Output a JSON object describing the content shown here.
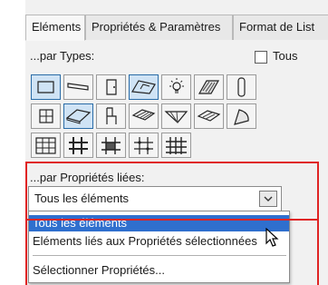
{
  "tabs": [
    "Eléments",
    "Propriétés & Paramètres",
    "Format de List"
  ],
  "types_section": {
    "label": "...par Types:",
    "all_label": "Tous",
    "all_checked": false,
    "row1": [
      {
        "name": "wall-tool-icon",
        "on": true
      },
      {
        "name": "beam-tool-icon",
        "on": false
      },
      {
        "name": "door-tool-icon",
        "on": false
      },
      {
        "name": "window-tool-icon",
        "on": true
      },
      {
        "name": "lamp-tool-icon",
        "on": false
      },
      {
        "name": "roof-tool-icon",
        "on": false
      },
      {
        "name": "column-tool-icon",
        "on": false
      }
    ],
    "row2": [
      {
        "name": "object-tool-icon",
        "on": false
      },
      {
        "name": "slab-tool-icon",
        "on": true
      },
      {
        "name": "chair-tool-icon",
        "on": false
      },
      {
        "name": "stair-tool-icon",
        "on": false
      },
      {
        "name": "mesh-tool-icon",
        "on": false
      },
      {
        "name": "morph-tool-icon",
        "on": false
      },
      {
        "name": "shell-tool-icon",
        "on": false
      }
    ],
    "row3": [
      {
        "name": "curtain-wall-tool-icon",
        "on": false
      },
      {
        "name": "frame-tool-icon",
        "on": false
      },
      {
        "name": "panel-tool-icon",
        "on": false
      },
      {
        "name": "junction-tool-icon",
        "on": false
      },
      {
        "name": "accessory-tool-icon",
        "on": false
      }
    ]
  },
  "linked_section": {
    "label": "...par Propriétés liées:",
    "selected": "Tous les éléments",
    "options": [
      "Tous les éléments",
      "Eléments liés aux Propriétés sélectionnées",
      "Sélectionner Propriétés..."
    ],
    "highlighted_index": 0
  },
  "colors": {
    "highlight": "#2f6fce",
    "toggle_on": "#cfe3f5",
    "callout": "#e02424"
  }
}
